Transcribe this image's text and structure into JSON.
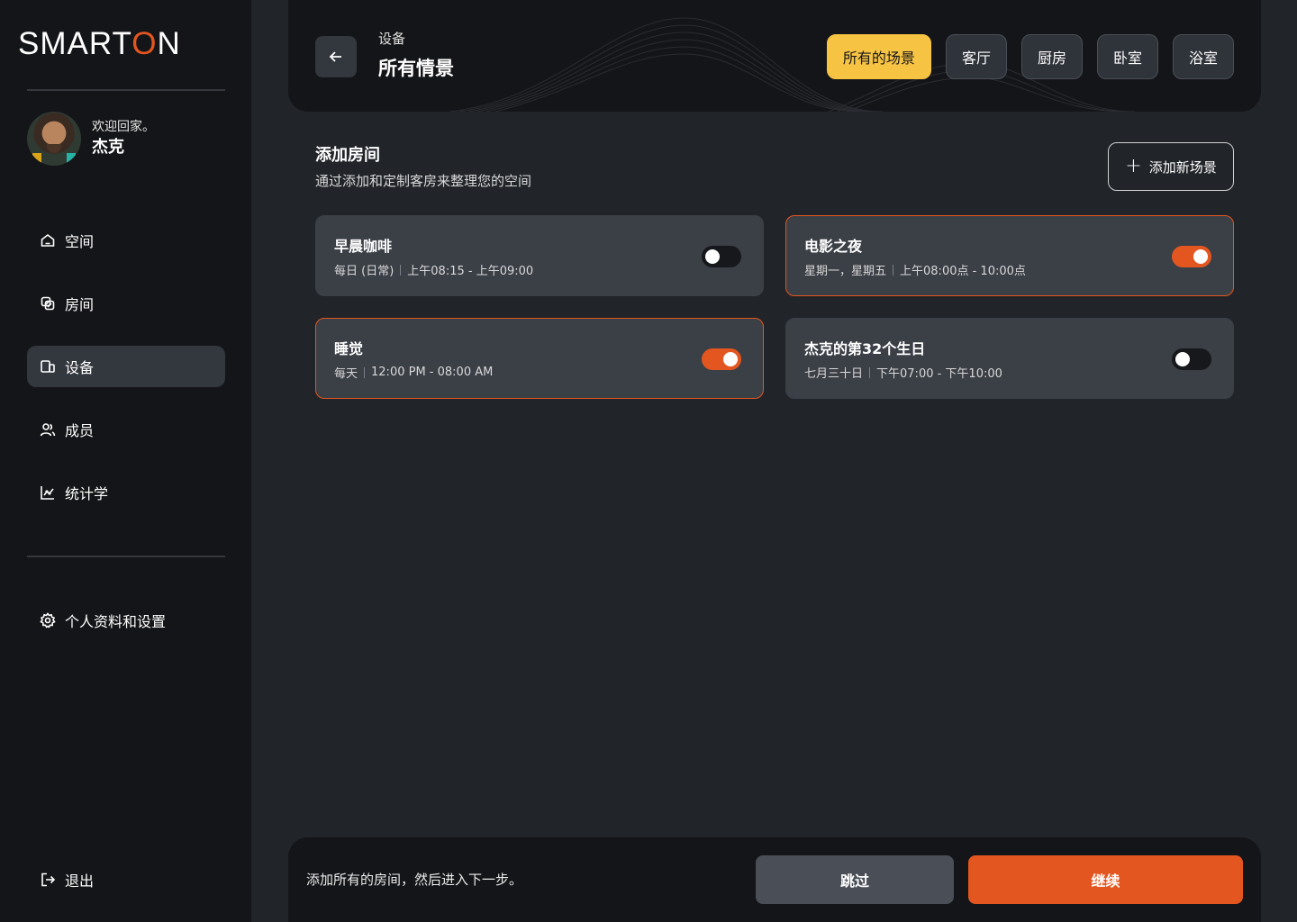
{
  "brand": {
    "logo_text_a": "SMART",
    "logo_text_o": "O",
    "logo_text_b": "N",
    "accent": "#e4561f"
  },
  "user": {
    "welcome": "欢迎回家。",
    "name": "杰克"
  },
  "sidebar": {
    "items": [
      {
        "label": "空间",
        "icon": "home-icon"
      },
      {
        "label": "房间",
        "icon": "rooms-icon"
      },
      {
        "label": "设备",
        "icon": "devices-icon",
        "active": true
      },
      {
        "label": "成员",
        "icon": "members-icon"
      },
      {
        "label": "统计学",
        "icon": "stats-icon"
      }
    ],
    "settings_label": "个人资料和设置",
    "logout_label": "退出"
  },
  "header": {
    "breadcrumb": "设备",
    "title": "所有情景",
    "tabs": [
      {
        "label": "所有的场景",
        "active": true
      },
      {
        "label": "客厅"
      },
      {
        "label": "厨房"
      },
      {
        "label": "卧室"
      },
      {
        "label": "浴室"
      }
    ]
  },
  "section": {
    "title": "添加房间",
    "subtitle": "通过添加和定制客房来整理您的空间",
    "add_button": "添加新场景"
  },
  "scenes": [
    {
      "title": "早晨咖啡",
      "days": "每日 (日常)",
      "time": "上午08:15 - 上午09:00",
      "on": false
    },
    {
      "title": "电影之夜",
      "days": "星期一，星期五",
      "time": "上午08:00点 - 10:00点",
      "on": true
    },
    {
      "title": "睡觉",
      "days": "每天",
      "time": "12:00 PM - 08:00 AM",
      "on": true
    },
    {
      "title": "杰克的第32个生日",
      "days": "七月三十日",
      "time": "下午07:00 - 下午10:00",
      "on": false
    }
  ],
  "footer": {
    "text": "添加所有的房间，然后进入下一步。",
    "skip": "跳过",
    "continue": "继续"
  }
}
